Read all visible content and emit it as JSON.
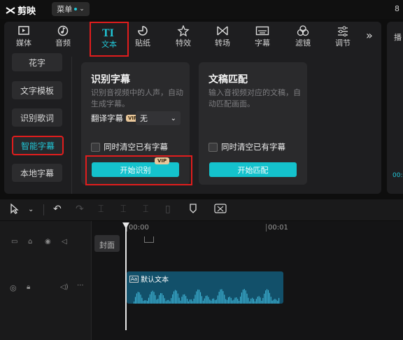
{
  "app": {
    "name": "剪映",
    "menu_label": "菜单",
    "edge_text": "8"
  },
  "categories": [
    {
      "label": "媒体",
      "icon": "media-icon"
    },
    {
      "label": "音频",
      "icon": "audio-icon"
    },
    {
      "label": "文本",
      "icon": "text-icon",
      "active": true
    },
    {
      "label": "贴纸",
      "icon": "sticker-icon"
    },
    {
      "label": "特效",
      "icon": "effects-icon"
    },
    {
      "label": "转场",
      "icon": "transition-icon"
    },
    {
      "label": "字幕",
      "icon": "subtitle-icon"
    },
    {
      "label": "滤镜",
      "icon": "filter-icon"
    },
    {
      "label": "调节",
      "icon": "adjust-icon"
    }
  ],
  "sidebar": [
    {
      "label": "花字"
    },
    {
      "label": "文字模板"
    },
    {
      "label": "识别歌词"
    },
    {
      "label": "智能字幕",
      "active": true
    },
    {
      "label": "本地字幕"
    }
  ],
  "card_recognize": {
    "title": "识别字幕",
    "desc": "识别音视频中的人声，自动生成字幕。",
    "translate_label": "翻译字幕",
    "vip_badge": "VIP",
    "translate_value": "无",
    "clear_label": "同时清空已有字幕",
    "button": "开始识别",
    "button_vip": "VIP"
  },
  "card_match": {
    "title": "文稿匹配",
    "desc": "输入音视频对应的文稿，自动匹配画面。",
    "clear_label": "同时清空已有字幕",
    "button": "开始匹配"
  },
  "right_panel": {
    "title_char": "播",
    "time_fragment": "00:"
  },
  "timeline": {
    "ruler": [
      "00:00",
      "00:01"
    ],
    "cover_label": "封面",
    "clip_label": "默认文本",
    "clip_tag": "Aa"
  },
  "colors": {
    "accent": "#21c6d6",
    "highlight": "#e11d1d",
    "clip": "#12506a"
  }
}
